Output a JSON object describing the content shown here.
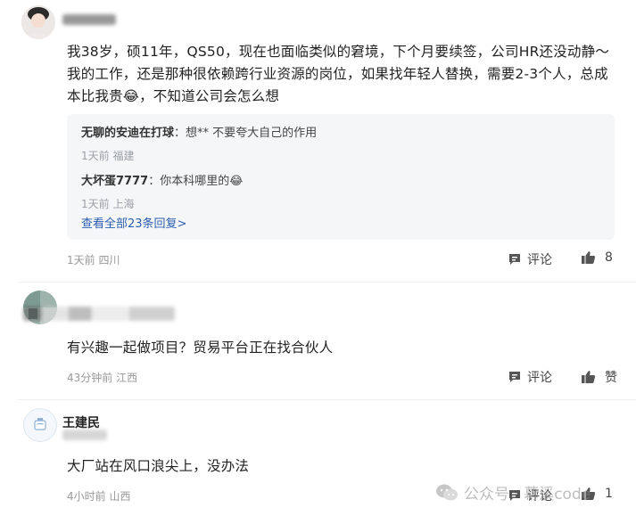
{
  "comments": [
    {
      "text": "我38岁，硕11年，QS50，现在也面临类似的窘境，下个月要续签，公司HR还没动静～我的工作，还是那种很依赖跨行业资源的岗位，如果找年轻人替换，需要2-3个人，总成本比我贵😂，不知道公司会怎么想",
      "replies": [
        {
          "name": "无聊的安迪在打球",
          "text": "想** 不要夸大自己的作用",
          "meta": "1天前 福建"
        },
        {
          "name": "大坏蛋7777",
          "text": "你本科哪里的😂",
          "meta": "1天前 上海"
        }
      ],
      "view_all": "查看全部23条回复>",
      "meta": "1天前 四川",
      "comment_label": "评论",
      "like_count": "8"
    },
    {
      "text": "有兴趣一起做项目？贸易平台正在找合伙人",
      "meta": "43分钟前 江西",
      "comment_label": "评论",
      "like_label": "赞"
    },
    {
      "username": "王建民",
      "text": "大厂站在风口浪尖上，没办法",
      "meta": "4小时前 山西",
      "comment_label": "评论",
      "like_count": "1"
    }
  ],
  "watermark": {
    "text": "公众号 · 幕溪code"
  },
  "colors": {
    "link": "#2a5db0",
    "meta": "#999999",
    "reply_bg": "#f5f6f8"
  }
}
